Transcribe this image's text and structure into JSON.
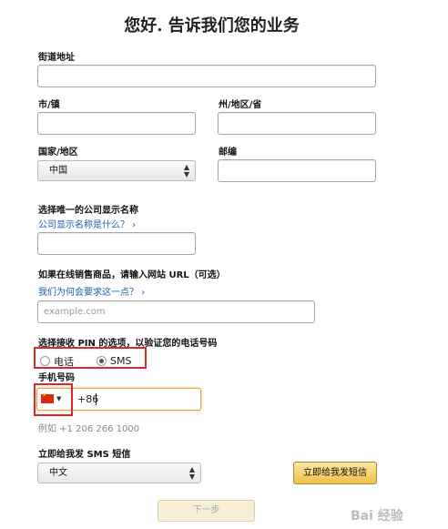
{
  "title": "您好. 告诉我们您的业务",
  "street": {
    "label": "街道地址",
    "value": ""
  },
  "city": {
    "label": "市/镇",
    "value": ""
  },
  "state": {
    "label": "州/地区/省",
    "value": ""
  },
  "country": {
    "label": "国家/地区",
    "selected": "中国"
  },
  "zip": {
    "label": "邮编",
    "value": ""
  },
  "display_name": {
    "label": "选择唯一的公司显示名称",
    "help_link": "公司显示名称是什么？ ›",
    "value": ""
  },
  "website": {
    "label": "如果在线销售商品，请输入网站 URL（可选）",
    "help_link": "我们为何会要求这一点？ ›",
    "placeholder": "example.com"
  },
  "pin_option": {
    "label": "选择接收 PIN 的选项，以验证您的电话号码",
    "options": [
      {
        "label": "电话",
        "selected": false
      },
      {
        "label": "SMS",
        "selected": true
      }
    ]
  },
  "mobile": {
    "label": "手机号码",
    "country_code": "+86",
    "example": "例如 +1 206 266 1000"
  },
  "sms": {
    "label": "立即给我发 SMS 短信",
    "language": "中文",
    "send_button": "立即给我发短信"
  },
  "next_button": "下一步",
  "watermark": "Bai 经验"
}
